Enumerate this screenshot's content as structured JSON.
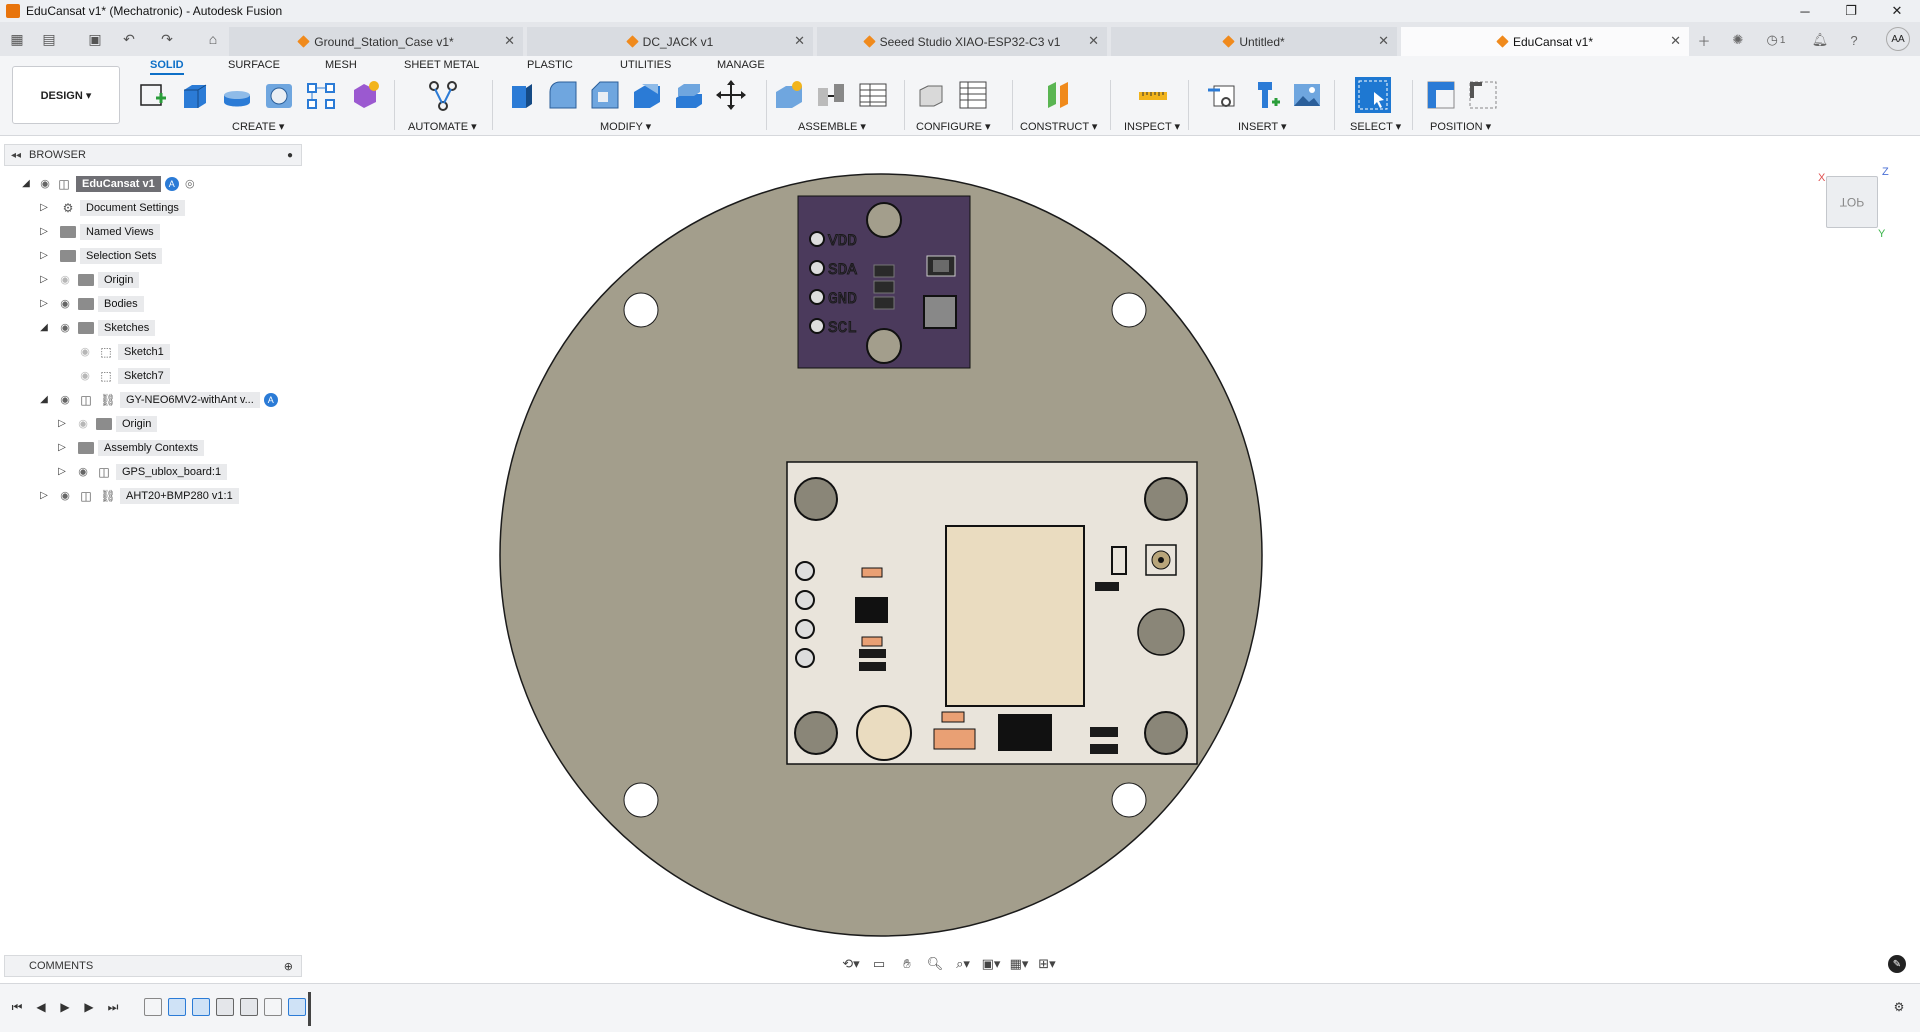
{
  "window": {
    "title": "EduCansat v1* (Mechatronic) - Autodesk Fusion",
    "controls": {
      "minimize": "─",
      "maximize": "❐",
      "close": "✕"
    }
  },
  "tabs": [
    {
      "label": "Ground_Station_Case v1*",
      "active": false
    },
    {
      "label": "DC_JACK v1",
      "active": false
    },
    {
      "label": "Seeed Studio XIAO-ESP32-C3 v1",
      "active": false
    },
    {
      "label": "Untitled*",
      "active": false
    },
    {
      "label": "EduCansat v1*",
      "active": true
    }
  ],
  "toolbar_right": {
    "job_count": "1",
    "avatar": "AA"
  },
  "ribbon": {
    "workspace": "DESIGN ▾",
    "tabs": [
      "SOLID",
      "SURFACE",
      "MESH",
      "SHEET METAL",
      "PLASTIC",
      "UTILITIES",
      "MANAGE"
    ],
    "active_tab": "SOLID",
    "groups": [
      "CREATE ▾",
      "AUTOMATE ▾",
      "MODIFY ▾",
      "ASSEMBLE ▾",
      "CONFIGURE ▾",
      "CONSTRUCT ▾",
      "INSPECT ▾",
      "INSERT ▾",
      "SELECT ▾",
      "POSITION ▾"
    ]
  },
  "browser": {
    "title": "BROWSER",
    "items": [
      {
        "label": "EduCansat v1",
        "level": 0,
        "expanded": true,
        "visible": true,
        "root": true
      },
      {
        "label": "Document Settings",
        "level": 1,
        "expanded": false
      },
      {
        "label": "Named Views",
        "level": 1,
        "expanded": false
      },
      {
        "label": "Selection Sets",
        "level": 1,
        "expanded": false
      },
      {
        "label": "Origin",
        "level": 1,
        "expanded": false,
        "visible": false
      },
      {
        "label": "Bodies",
        "level": 1,
        "expanded": false,
        "visible": true
      },
      {
        "label": "Sketches",
        "level": 1,
        "expanded": true,
        "visible": true
      },
      {
        "label": "Sketch1",
        "level": 2,
        "visible": false
      },
      {
        "label": "Sketch7",
        "level": 2,
        "visible": false
      },
      {
        "label": "GY-NEO6MV2-withAnt v...",
        "level": 1,
        "expanded": true,
        "visible": true
      },
      {
        "label": "Origin",
        "level": 2,
        "expanded": false,
        "visible": false
      },
      {
        "label": "Assembly Contexts",
        "level": 2,
        "expanded": false
      },
      {
        "label": "GPS_ublox_board:1",
        "level": 2,
        "expanded": false,
        "visible": true
      },
      {
        "label": "AHT20+BMP280 v1:1",
        "level": 1,
        "expanded": false,
        "visible": true
      }
    ]
  },
  "comments": {
    "title": "COMMENTS"
  },
  "viewcube": {
    "face": "TOP",
    "axis_x": "X",
    "axis_y": "Y",
    "axis_z": "Z"
  },
  "sensor_pins": [
    "VDD",
    "SDA",
    "GND",
    "SCL"
  ],
  "colors": {
    "accent": "#0d6fc7",
    "disc": "#a39e8c",
    "sensor_pcb": "#4b3a5c",
    "gps_pcb": "#e9e4db"
  }
}
